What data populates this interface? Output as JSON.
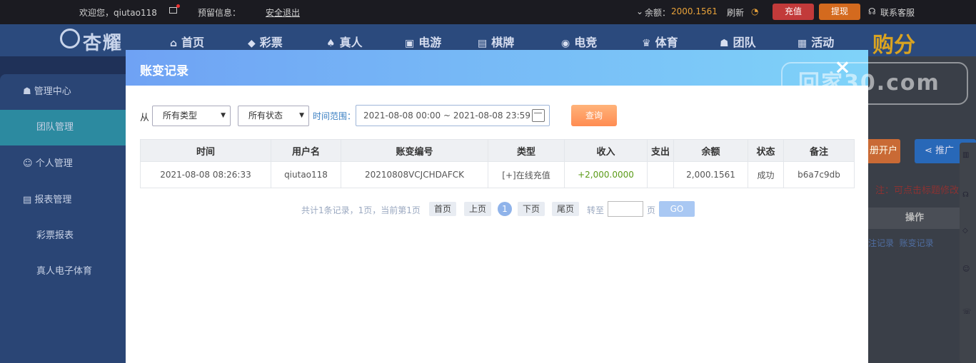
{
  "topbar": {
    "welcome": "欢迎您，qiutao118",
    "reserved_info": "预留信息：",
    "logout": "安全退出",
    "balance_label": "余额：",
    "balance_value": "2000.1561",
    "refresh": "刷新",
    "recharge": "充值",
    "withdraw": "提现",
    "support": "联系客服"
  },
  "nav": {
    "logo": "杏耀",
    "items": [
      "首页",
      "彩票",
      "真人",
      "电游",
      "棋牌",
      "电竞",
      "体育",
      "团队",
      "活动"
    ],
    "buy_points": "购分"
  },
  "sidebar": {
    "items": [
      "管理中心",
      "团队管理",
      "个人管理",
      "报表管理",
      "彩票报表",
      "真人电子体育"
    ]
  },
  "background_right": {
    "open_account": "册开户",
    "promote": "推广",
    "note": "注：可点击标题修改",
    "op_header": "操作",
    "link1": "注记录",
    "link2": "账变记录"
  },
  "watermark": "回家30.com",
  "modal": {
    "title": "账变记录",
    "close": "×",
    "from": "从",
    "type_select": "所有类型",
    "status_select": "所有状态",
    "range_label": "时间范围：",
    "date_range": "2021-08-08 00:00 ~ 2021-08-08 23:59",
    "query": "查询",
    "columns": [
      "时间",
      "用户名",
      "账变编号",
      "类型",
      "收入",
      "支出",
      "余额",
      "状态",
      "备注"
    ],
    "rows": [
      {
        "time": "2021-08-08 08:26:33",
        "user": "qiutao118",
        "id": "20210808VCJCHDAFCK",
        "type": "[+]在线充值",
        "income": "+2,000.0000",
        "expense": "",
        "balance": "2,000.1561",
        "status": "成功",
        "remark": "b6a7c9db"
      }
    ],
    "pager": {
      "summary": "共计1条记录，1页，当前第1页",
      "first": "首页",
      "prev": "上页",
      "current": "1",
      "next": "下页",
      "last": "尾页",
      "goto": "转至",
      "page_unit": "页",
      "go": "GO"
    }
  }
}
